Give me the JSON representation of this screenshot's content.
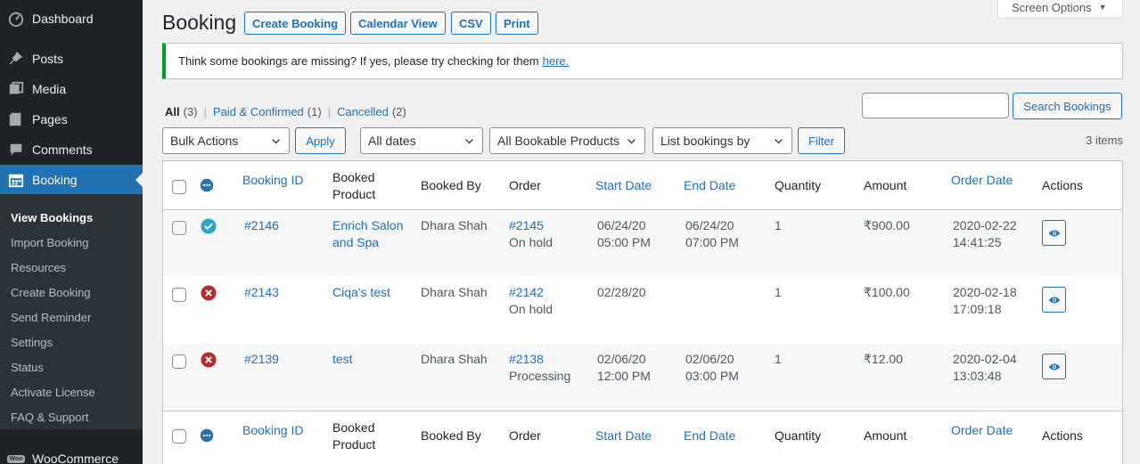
{
  "sidebar": {
    "items": [
      {
        "label": "Dashboard",
        "icon": "dashboard-icon"
      },
      {
        "label": "Posts",
        "icon": "pin-icon"
      },
      {
        "label": "Media",
        "icon": "media-icon"
      },
      {
        "label": "Pages",
        "icon": "pages-icon"
      },
      {
        "label": "Comments",
        "icon": "comments-icon"
      },
      {
        "label": "Booking",
        "icon": "calendar-icon"
      }
    ],
    "submenu": [
      "View Bookings",
      "Import Booking",
      "Resources",
      "Create Booking",
      "Send Reminder",
      "Settings",
      "Status",
      "Activate License",
      "FAQ & Support"
    ],
    "woo": {
      "badge": "Woo",
      "label": "WooCommerce"
    }
  },
  "header": {
    "title": "Booking",
    "buttons": [
      "Create Booking",
      "Calendar View",
      "CSV",
      "Print"
    ],
    "screen_options": "Screen Options"
  },
  "notice": {
    "text": "Think some bookings are missing? If yes, please try checking for them",
    "link": "here."
  },
  "views": {
    "all": {
      "label": "All",
      "count": "(3)"
    },
    "paid": {
      "label": "Paid & Confirmed",
      "count": "(1)"
    },
    "cancelled": {
      "label": "Cancelled",
      "count": "(2)"
    }
  },
  "search": {
    "value": "",
    "button": "Search Bookings"
  },
  "filters": {
    "bulk_actions": "Bulk Actions",
    "apply": "Apply",
    "dates": "All dates",
    "products": "All Bookable Products",
    "list_by": "List bookings by",
    "filter": "Filter",
    "items_count": "3 items"
  },
  "table": {
    "columns": {
      "booking_id": "Booking ID",
      "booked_product_1": "Booked",
      "booked_product_2": "Product",
      "booked_by": "Booked By",
      "order": "Order",
      "start_date": "Start Date",
      "end_date": "End Date",
      "quantity": "Quantity",
      "amount": "Amount",
      "order_date": "Order Date",
      "actions": "Actions"
    },
    "rows": [
      {
        "status": "confirmed",
        "id": "#2146",
        "product_1": "Enrich Salon",
        "product_2": "and Spa",
        "booked_by": "Dhara Shah",
        "order": "#2145",
        "order_status": "On hold",
        "start_1": "06/24/20",
        "start_2": "05:00 PM",
        "end_1": "06/24/20",
        "end_2": "07:00 PM",
        "quantity": "1",
        "amount": "₹900.00",
        "order_date_1": "2020-02-22",
        "order_date_2": "14:41:25"
      },
      {
        "status": "cancelled",
        "id": "#2143",
        "product_1": "Ciqa's test",
        "product_2": "",
        "booked_by": "Dhara Shah",
        "order": "#2142",
        "order_status": "On hold",
        "start_1": "02/28/20",
        "start_2": "",
        "end_1": "",
        "end_2": "",
        "quantity": "1",
        "amount": "₹100.00",
        "order_date_1": "2020-02-18",
        "order_date_2": "17:09:18"
      },
      {
        "status": "cancelled",
        "id": "#2139",
        "product_1": "test",
        "product_2": "",
        "booked_by": "Dhara Shah",
        "order": "#2138",
        "order_status": "Processing",
        "start_1": "02/06/20",
        "start_2": "12:00 PM",
        "end_1": "02/06/20",
        "end_2": "03:00 PM",
        "quantity": "1",
        "amount": "₹12.00",
        "order_date_1": "2020-02-04",
        "order_date_2": "13:03:48"
      }
    ]
  },
  "colors": {
    "accent": "#2271b1",
    "sidebar": "#1d2327",
    "confirmed": "#2ea2cc",
    "cancelled": "#b32d2e",
    "notice": "#00a32a"
  }
}
